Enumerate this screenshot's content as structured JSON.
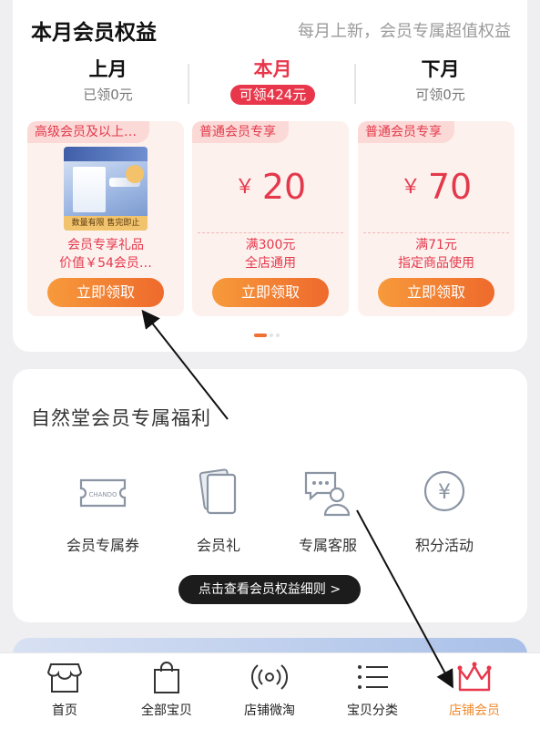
{
  "benefits": {
    "title": "本月会员权益",
    "subtitle": "每月上新，会员专属超值权益",
    "months": [
      {
        "name": "上月",
        "amount": "已领0元"
      },
      {
        "name": "本月",
        "amount": "可领424元"
      },
      {
        "name": "下月",
        "amount": "可领0元"
      }
    ],
    "coupons": [
      {
        "tag": "高级会员及以上…",
        "line1": "会员专享礼品",
        "line2": "价值￥54会员…",
        "button": "立即领取",
        "image_caption": "数量有限 售完即止"
      },
      {
        "tag": "普通会员专享",
        "currency": "￥",
        "value": "20",
        "line1": "满300元",
        "line2": "全店通用",
        "button": "立即领取"
      },
      {
        "tag": "普通会员专享",
        "currency": "￥",
        "value": "70",
        "line1": "满71元",
        "line2": "指定商品使用",
        "button": "立即领取"
      }
    ],
    "pagination": {
      "pages": 3,
      "active": 1
    }
  },
  "welfare": {
    "title": "自然堂会员专属福利",
    "items": [
      {
        "label": "会员专属券",
        "icon": "ticket-icon"
      },
      {
        "label": "会员礼",
        "icon": "gift-card-icon"
      },
      {
        "label": "专属客服",
        "icon": "customer-service-icon"
      },
      {
        "label": "积分活动",
        "icon": "yen-coin-icon"
      }
    ],
    "detail_button": "点击查看会员权益细则 >",
    "ticket_brand": "CHANDO"
  },
  "tabbar": {
    "items": [
      {
        "label": "首页",
        "icon": "storefront-icon"
      },
      {
        "label": "全部宝贝",
        "icon": "shopping-bag-icon"
      },
      {
        "label": "店铺微淘",
        "icon": "broadcast-icon"
      },
      {
        "label": "宝贝分类",
        "icon": "list-icon"
      },
      {
        "label": "店铺会员",
        "icon": "crown-icon"
      }
    ],
    "active_index": 4
  },
  "colors": {
    "accent_red": "#e8364a",
    "accent_orange": "#f08a2c",
    "button_gradient_start": "#f79a3b",
    "button_gradient_end": "#ee6a2c"
  }
}
